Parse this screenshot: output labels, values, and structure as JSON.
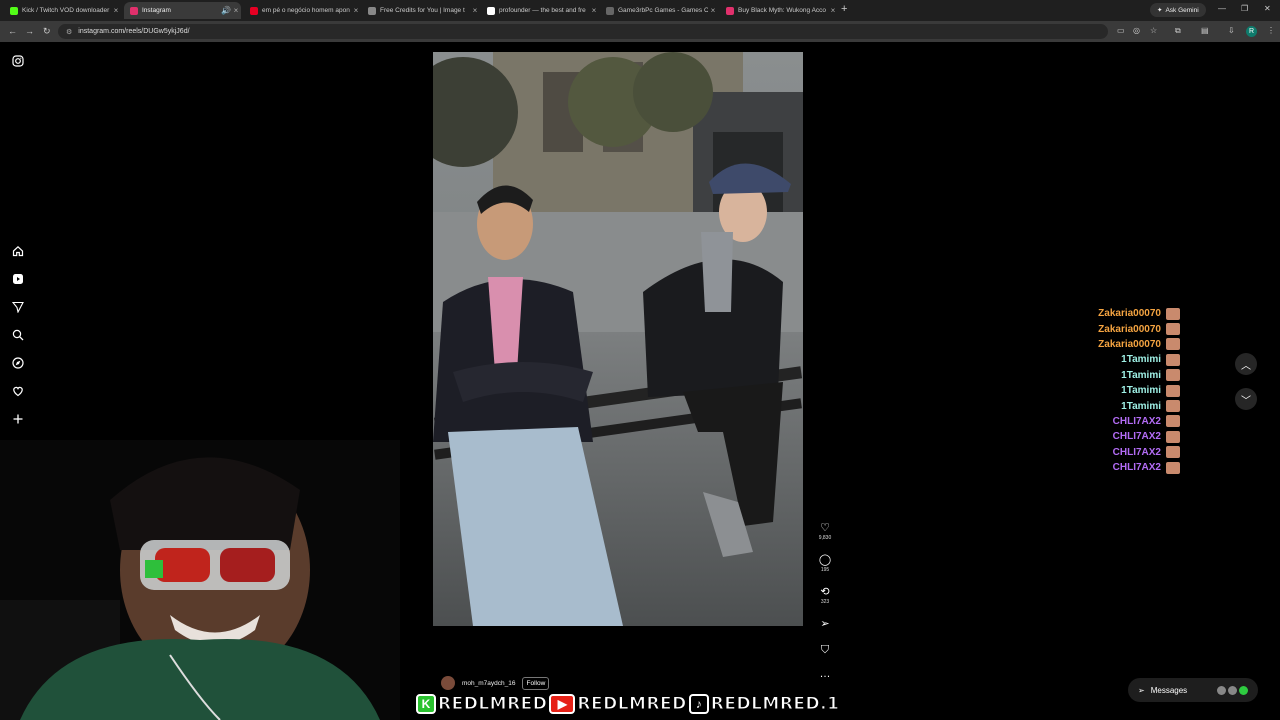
{
  "browser": {
    "tabs": [
      {
        "label": "Kick / Twitch VOD downloader",
        "favicon_color": "#53fc18"
      },
      {
        "label": "Instagram",
        "favicon_color": "#e1306c",
        "active": true
      },
      {
        "label": "em pé o negócio homem apon",
        "favicon_color": "#e60023"
      },
      {
        "label": "Free Credits for You | Image t",
        "favicon_color": "#888888"
      },
      {
        "label": "profounder — the best and fre",
        "favicon_color": "#ffffff"
      },
      {
        "label": "Game3rbPc Games - Games Of",
        "favicon_color": "#666666"
      },
      {
        "label": "Buy Black Myth: Wukong Acco",
        "favicon_color": "#e1306c"
      }
    ],
    "new_tab": "+",
    "ask_gemini": "Ask Gemini",
    "url": "instagram.com/reels/DUGw5ykjJ6d/",
    "profile_initial": "R"
  },
  "nav": {
    "icons": [
      "instagram-logo-icon",
      "home-icon",
      "reels-icon",
      "send-icon",
      "search-icon",
      "explore-icon",
      "heart-icon",
      "create-icon",
      "dashboard-icon",
      "profile-icon"
    ]
  },
  "reel": {
    "author": "moh_m7aydch_16",
    "follow_label": "Follow",
    "likes": "9,830",
    "comments": "195",
    "reposts": "323"
  },
  "chat": [
    {
      "user": "Zakaria00070",
      "color": "#f5a441"
    },
    {
      "user": "Zakaria00070",
      "color": "#f5a441"
    },
    {
      "user": "Zakaria00070",
      "color": "#f5a441"
    },
    {
      "user": "1Tamimi",
      "color": "#9ff0e5"
    },
    {
      "user": "1Tamimi",
      "color": "#9ff0e5"
    },
    {
      "user": "1Tamimi",
      "color": "#9ff0e5"
    },
    {
      "user": "1Tamimi",
      "color": "#9ff0e5"
    },
    {
      "user": "CHLI7AX2",
      "color": "#b36cf5"
    },
    {
      "user": "CHLI7AX2",
      "color": "#b36cf5"
    },
    {
      "user": "CHLI7AX2",
      "color": "#b36cf5"
    },
    {
      "user": "CHLI7AX2",
      "color": "#b36cf5"
    }
  ],
  "messages_label": "Messages",
  "banner": {
    "kick": "REDLMRED",
    "youtube": "REDLMRED",
    "tiktok": "REDLMRED.1"
  }
}
